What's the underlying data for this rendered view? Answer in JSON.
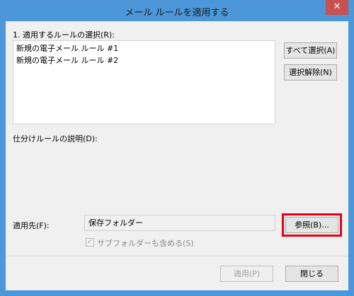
{
  "window": {
    "title": "メール ルールを適用する",
    "close_glyph": "✕"
  },
  "rules_section": {
    "label": "1. 適用するルールの選択(R):",
    "items": [
      {
        "label": "新規の電子メール ルール #1"
      },
      {
        "label": "新規の電子メール ルール #2"
      }
    ],
    "select_all_label": "すべて選択(A)",
    "deselect_label": "選択解除(N)"
  },
  "description_section": {
    "label": "仕分けルールの説明(D):"
  },
  "apply_to": {
    "label": "適用先(F):",
    "folder_value": "保存フォルダー",
    "browse_label": "参照(B)...",
    "include_subfolders_label": "サブフォルダーも含める(S)",
    "include_subfolders_checked": true,
    "check_glyph": "✓"
  },
  "footer": {
    "apply_label": "適用(P)",
    "close_label": "閉じる"
  },
  "colors": {
    "window_border": "#4b97d9",
    "close_button": "#c75050",
    "highlight_box": "#e60012",
    "client_background": "#f0f0f0"
  }
}
